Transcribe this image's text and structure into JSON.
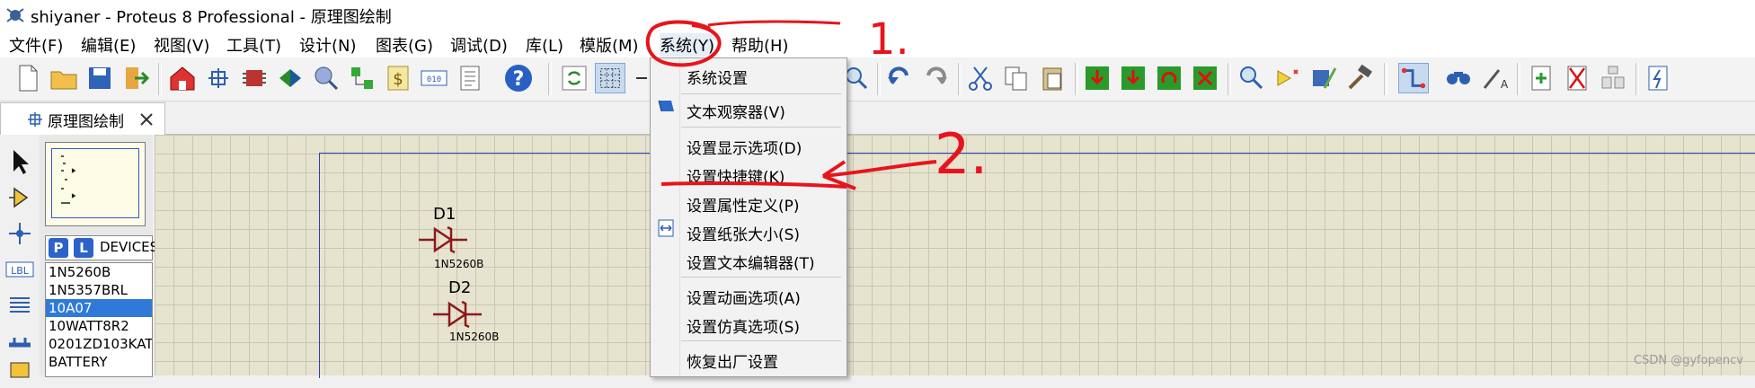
{
  "window": {
    "title": "shiyaner - Proteus 8 Professional - 原理图绘制"
  },
  "menu": {
    "items": [
      "文件(F)",
      "编辑(E)",
      "视图(V)",
      "工具(T)",
      "设计(N)",
      "图表(G)",
      "调试(D)",
      "库(L)",
      "模版(M)",
      "系统(Y)",
      "帮助(H)"
    ]
  },
  "tab": {
    "label": "原理图绘制"
  },
  "picker": {
    "p": "P",
    "l": "L",
    "label": "DEVICES"
  },
  "devices": [
    "1N5260B",
    "1N5357BRL",
    "10A07",
    "10WATT8R2",
    "0201ZD103KAT",
    "BATTERY"
  ],
  "selected_device": "10A07",
  "canvas": {
    "d1_ref": "D1",
    "d1_val": "1N5260B",
    "d2_ref": "D2",
    "d2_val": "1N5260B"
  },
  "system_menu": {
    "items": [
      "系统设置",
      "文本观察器(V)",
      "设置显示选项(D)",
      "设置快捷键(K)",
      "设置属性定义(P)",
      "设置纸张大小(S)",
      "设置文本编辑器(T)",
      "设置动画选项(A)",
      "设置仿真选项(S)",
      "恢复出厂设置"
    ]
  },
  "annotations": {
    "one": "1.",
    "two": "2."
  },
  "watermark": "CSDN @gyfopencv",
  "colors": {
    "annotation": "#e8141c",
    "selection": "#2f7ad8",
    "canvas": "#e6e3cf",
    "component": "#8b1a1a"
  }
}
